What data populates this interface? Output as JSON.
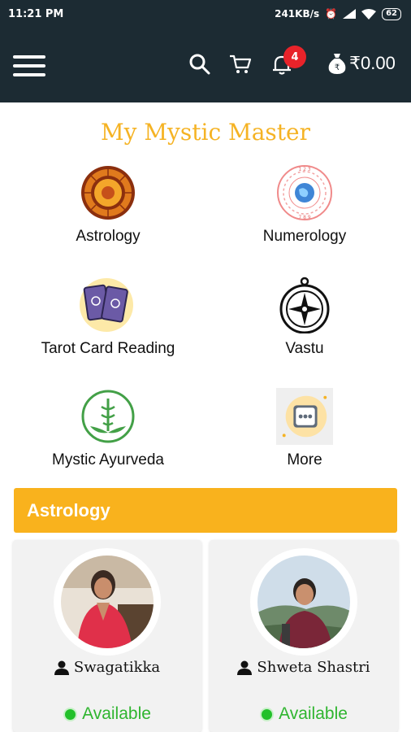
{
  "status_bar": {
    "time": "11:21 PM",
    "speed": "241KB/s",
    "battery": "62"
  },
  "header": {
    "notification_count": "4",
    "wallet_balance": "₹0.00"
  },
  "title": "My Mystic Master",
  "services": [
    {
      "label": "Astrology",
      "icon": "zodiac-wheel-icon"
    },
    {
      "label": "Numerology",
      "icon": "numerology-globe-icon"
    },
    {
      "label": "Tarot Card Reading",
      "icon": "tarot-cards-icon"
    },
    {
      "label": "Vastu",
      "icon": "compass-icon"
    },
    {
      "label": "Mystic Ayurveda",
      "icon": "caduceus-leaf-icon"
    },
    {
      "label": "More",
      "icon": "more-dots-icon"
    }
  ],
  "section": {
    "title": "Astrology"
  },
  "astrologers": [
    {
      "name": "Swagatikka",
      "status": "Available"
    },
    {
      "name": "Shweta Shastri",
      "status": "Available"
    }
  ],
  "colors": {
    "app_bar": "#1c2b33",
    "accent": "#f9b21d",
    "title": "#f5b324",
    "available": "#22c02a",
    "badge": "#e8232a"
  }
}
